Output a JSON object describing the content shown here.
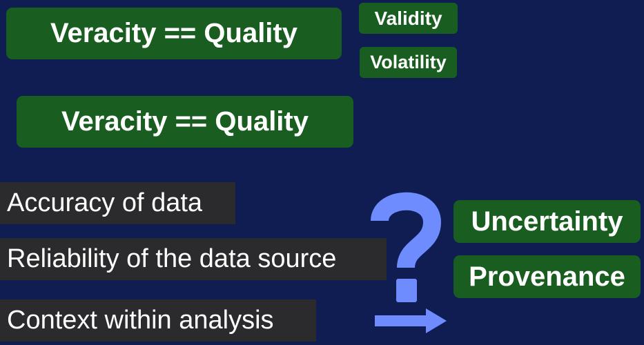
{
  "titles": {
    "first": "Veracity == Quality",
    "second": "Veracity == Quality"
  },
  "tags": {
    "validity": "Validity",
    "volatility": "Volatility",
    "uncertainty": "Uncertainty",
    "provenance": "Provenance"
  },
  "items": [
    "Accuracy of data",
    "Reliability of the data source",
    "Context within analysis"
  ],
  "icons": [
    "question-mark-icon",
    "right-arrow-icon"
  ],
  "colors": {
    "background": "#0f1d52",
    "green_box": "#195e20",
    "dark_box": "#2b2b2e",
    "accent_blue": "#6f8cff",
    "text": "#ffffff"
  }
}
